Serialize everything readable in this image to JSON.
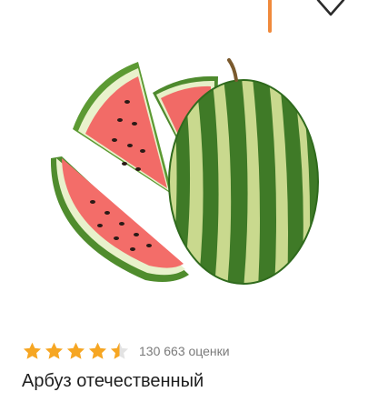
{
  "product": {
    "image_subject": "watermelon",
    "rating": 4.5,
    "rating_max": 5,
    "rating_count_text": "130 663 оценки",
    "title": "Арбуз отечественный"
  },
  "colors": {
    "star": "#f6a623",
    "accent": "#f08a3c",
    "title": "#1f1f1f",
    "muted": "#7a7a7a"
  },
  "icons": {
    "favorite": "heart-outline-icon",
    "rating": "star-icon"
  }
}
